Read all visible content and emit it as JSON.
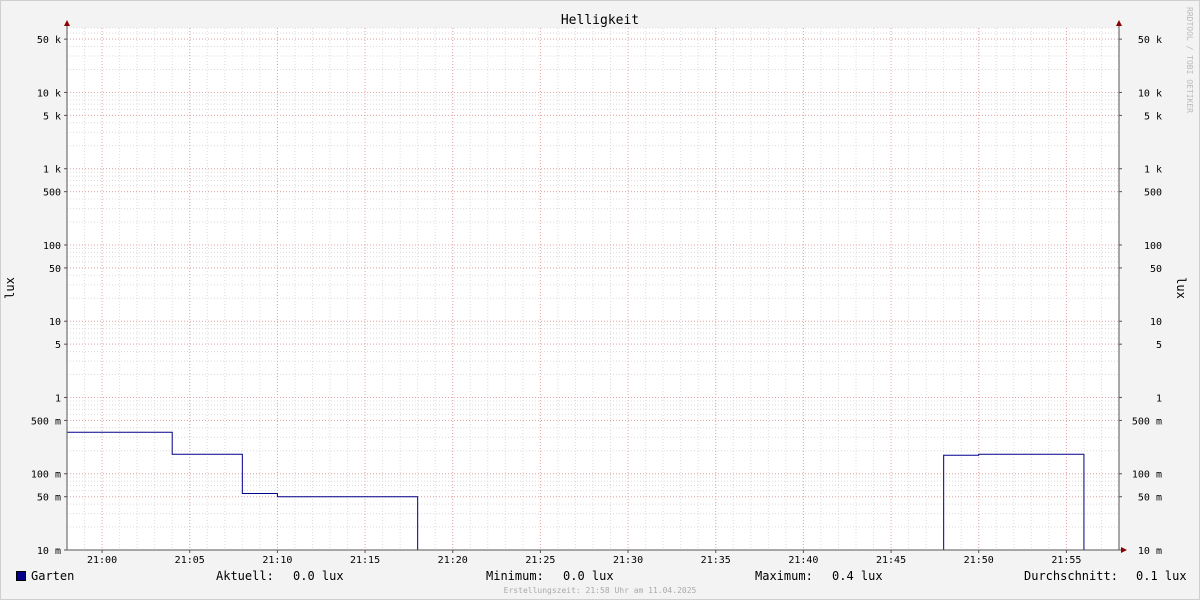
{
  "chart_data": {
    "type": "line",
    "title": "Helligkeit",
    "ylabel": "lux",
    "yscale": "log",
    "ylim": [
      10,
      70000
    ],
    "xlim": [
      "20:58",
      "21:58"
    ],
    "x_ticks": [
      "21:00",
      "21:05",
      "21:10",
      "21:15",
      "21:20",
      "21:25",
      "21:30",
      "21:35",
      "21:40",
      "21:45",
      "21:50",
      "21:55"
    ],
    "y_ticks": [
      {
        "value": 50000,
        "label": "50 k"
      },
      {
        "value": 10000,
        "label": "10 k"
      },
      {
        "value": 5000,
        "label": "5 k"
      },
      {
        "value": 1000,
        "label": "1 k"
      },
      {
        "value": 500,
        "label": "500"
      },
      {
        "value": 100,
        "label": "100"
      },
      {
        "value": 50,
        "label": "50"
      },
      {
        "value": 10,
        "label": "10"
      },
      {
        "value": 5,
        "label": "5"
      },
      {
        "value": 1,
        "label": "1"
      },
      {
        "value": 0.5,
        "label": "500 m"
      },
      {
        "value": 0.1,
        "label": "100 m"
      },
      {
        "value": 0.05,
        "label": "50 m"
      },
      {
        "value": 0.01,
        "label": "10 m"
      }
    ],
    "grid": true,
    "series": [
      {
        "name": "Garten",
        "color": "#00008b",
        "step": true,
        "points": [
          [
            "20:58",
            0.35
          ],
          [
            "21:04",
            0.18
          ],
          [
            "21:08",
            0.055
          ],
          [
            "21:10",
            0.05
          ],
          [
            "21:18",
            0.0
          ],
          [
            "21:48",
            0.175
          ],
          [
            "21:50",
            0.18
          ],
          [
            "21:56",
            0.0
          ],
          [
            "21:58",
            0.0
          ]
        ]
      }
    ]
  },
  "legend": {
    "series_name": "Garten",
    "current_label": "Aktuell:",
    "current_value": "0.0 lux",
    "min_label": "Minimum:",
    "min_value": "0.0 lux",
    "max_label": "Maximum:",
    "max_value": "0.4 lux",
    "avg_label": "Durchschnitt:",
    "avg_value": "0.1 lux"
  },
  "footer": "Erstellungszeit: 21:58 Uhr am 11.04.2025",
  "watermark": "RRDTOOL / TOBI OETIKER"
}
